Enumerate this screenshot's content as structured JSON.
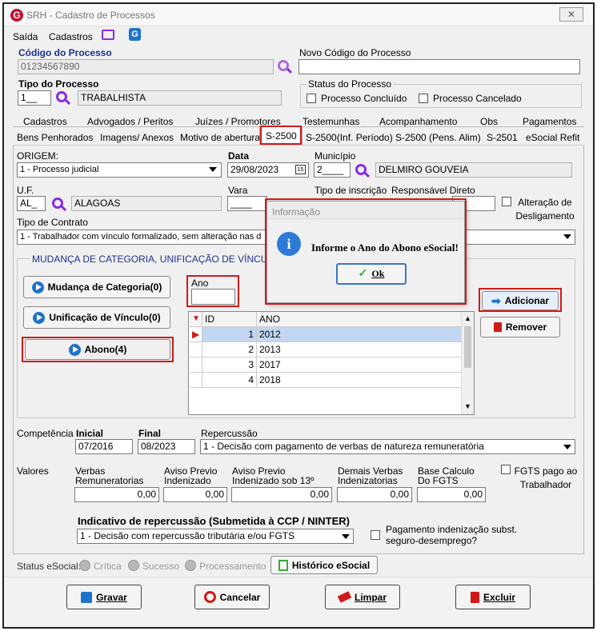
{
  "title": "SRH - Cadastro de Processos",
  "menu": [
    "Saída",
    "Cadastros"
  ],
  "codigo": {
    "label": "Código do Processo",
    "value": "01234567890"
  },
  "novo_codigo": {
    "label": "Novo Código do Processo",
    "value": ""
  },
  "tipo": {
    "label": "Tipo do Processo",
    "code": "1__",
    "name": "TRABALHISTA"
  },
  "status_processo": {
    "label": "Status do Processo",
    "concluido": "Processo Concluído",
    "cancelado": "Processo Cancelado"
  },
  "tabs_row1": [
    "Cadastros",
    "Advogados / Peritos",
    "Juízes / Promotores",
    "Testemunhas",
    "Acompanhamento",
    "Obs",
    "Pagamentos"
  ],
  "tabs_row2": [
    "Bens Penhorados",
    "Imagens/ Anexos",
    "Motivo de abertura",
    "S-2500",
    "S-2500(Inf. Período)",
    "S-2500 (Pens. Alim)",
    "S-2501",
    "eSocial Refit"
  ],
  "origem": {
    "label": "ORIGEM:",
    "value": "1 - Processo judicial"
  },
  "data": {
    "label": "Data",
    "value": "29/08/2023"
  },
  "municipio": {
    "label": "Município",
    "code": "2____",
    "name": "DELMIRO GOUVEIA"
  },
  "uf": {
    "label": "U.F.",
    "code": "AL_",
    "name": "ALAGOAS"
  },
  "vara": {
    "label": "Vara",
    "value": "____"
  },
  "tipo_inscricao": {
    "label": "Tipo de inscrição"
  },
  "responsavel": {
    "label": "Responsável Direto"
  },
  "alteracao": "Alteração de Desligamento",
  "tipo_contrato": {
    "label": "Tipo de Contrato",
    "value": "1 - Trabalhador com vínculo formalizado, sem alteração nas d"
  },
  "mudanca_group": "MUDANÇA DE CATEGORIA, UNIFICAÇÃO DE VÍNCULO",
  "btn_mudanca": "Mudança de Categoria(0)",
  "btn_unificacao": "Unificação de Vínculo(0)",
  "btn_abono": "Abono(4)",
  "ano": {
    "label": "Ano",
    "value": ""
  },
  "grid": {
    "columns": [
      "ID",
      "ANO"
    ],
    "rows": [
      {
        "id": "1",
        "ano": "2012"
      },
      {
        "id": "2",
        "ano": "2013"
      },
      {
        "id": "3",
        "ano": "2017"
      },
      {
        "id": "4",
        "ano": "2018"
      }
    ]
  },
  "btn_adicionar": "Adicionar",
  "btn_remover": "Remover",
  "dialog": {
    "title": "Informação",
    "message": "Informe o Ano do Abono eSocial!",
    "ok": "Ok"
  },
  "competencia": {
    "label": "Competência",
    "inicial_label": "Inicial",
    "inicial": "07/2016",
    "final_label": "Final",
    "final": "08/2023"
  },
  "repercussao": {
    "label": "Repercussão",
    "value": "1 - Decisão com pagamento de verbas de natureza remuneratória"
  },
  "valores": {
    "label": "Valores",
    "verbas_label": "Verbas Remuneratorias",
    "verbas": "0,00",
    "aviso_label": "Aviso Previo Indenizado",
    "aviso": "0,00",
    "aviso13_label": "Aviso Previo Indenizado sob 13º",
    "aviso13": "0,00",
    "demais_label": "Demais Verbas Indenizatorias",
    "demais": "0,00",
    "base_label": "Base Calculo Do FGTS",
    "base": "0,00"
  },
  "fgts_pago": "FGTS pago ao Trabalhador",
  "indicativo": {
    "label": "Indicativo de repercussão (Submetida à CCP / NINTER)",
    "value": "1 - Decisão com repercussão tributária e/ou FGTS"
  },
  "pagamento_indenizacao": "Pagamento indenização subst. seguro-desemprego?",
  "status_esocial": {
    "label": "Status eSocial:",
    "options": [
      "Crítica",
      "Sucesso",
      "Processamento"
    ]
  },
  "historico": "Histórico eSocial",
  "footer": {
    "gravar": "Gravar",
    "cancelar": "Cancelar",
    "limpar": "Limpar",
    "excluir": "Excluir"
  }
}
